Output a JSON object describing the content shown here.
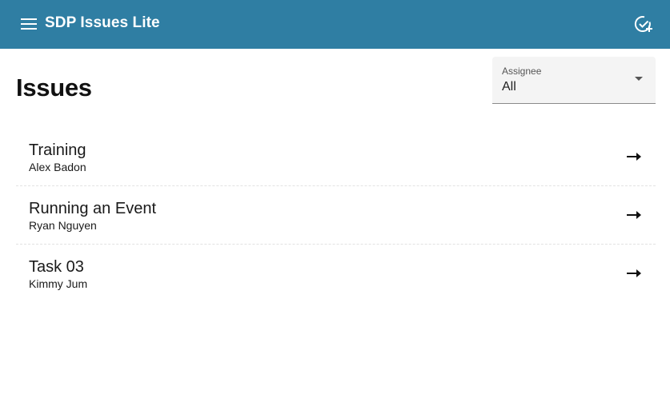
{
  "app": {
    "title": "SDP Issues Lite",
    "header_color": "#2f7ea3",
    "menu_icon": "menu-icon",
    "action_icon": "add-task-icon"
  },
  "page": {
    "title": "Issues"
  },
  "filter": {
    "label": "Assignee",
    "selected": "All",
    "icon": "chevron-down-icon"
  },
  "issues": [
    {
      "title": "Training",
      "assignee": "Alex Badon",
      "icon": "arrow-right-icon"
    },
    {
      "title": "Running an Event",
      "assignee": "Ryan Nguyen",
      "icon": "arrow-right-icon"
    },
    {
      "title": "Task 03",
      "assignee": "Kimmy Jum",
      "icon": "arrow-right-icon"
    }
  ]
}
